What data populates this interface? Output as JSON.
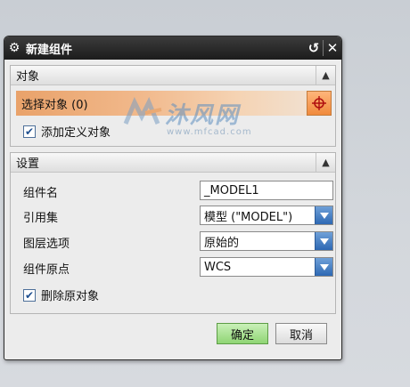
{
  "dialog": {
    "title": "新建组件"
  },
  "object_group": {
    "header": "对象",
    "select_label": "选择对象 (0)",
    "add_defined_label": "添加定义对象",
    "add_defined_checked": true
  },
  "settings_group": {
    "header": "设置",
    "component_name_label": "组件名",
    "component_name_value": "_MODEL1",
    "reference_set_label": "引用集",
    "reference_set_value": "模型 (\"MODEL\")",
    "layer_option_label": "图层选项",
    "layer_option_value": "原始的",
    "origin_label": "组件原点",
    "origin_value": "WCS",
    "delete_original_label": "删除原对象",
    "delete_original_checked": true
  },
  "footer": {
    "ok_label": "确定",
    "cancel_label": "取消"
  },
  "watermark": {
    "text_cn": "沐风网",
    "url": "www.mfcad.com"
  },
  "colors": {
    "selection_highlight": "#f1b98c",
    "ok_button": "#8fd574",
    "combo_arrow": "#2d68b3"
  }
}
